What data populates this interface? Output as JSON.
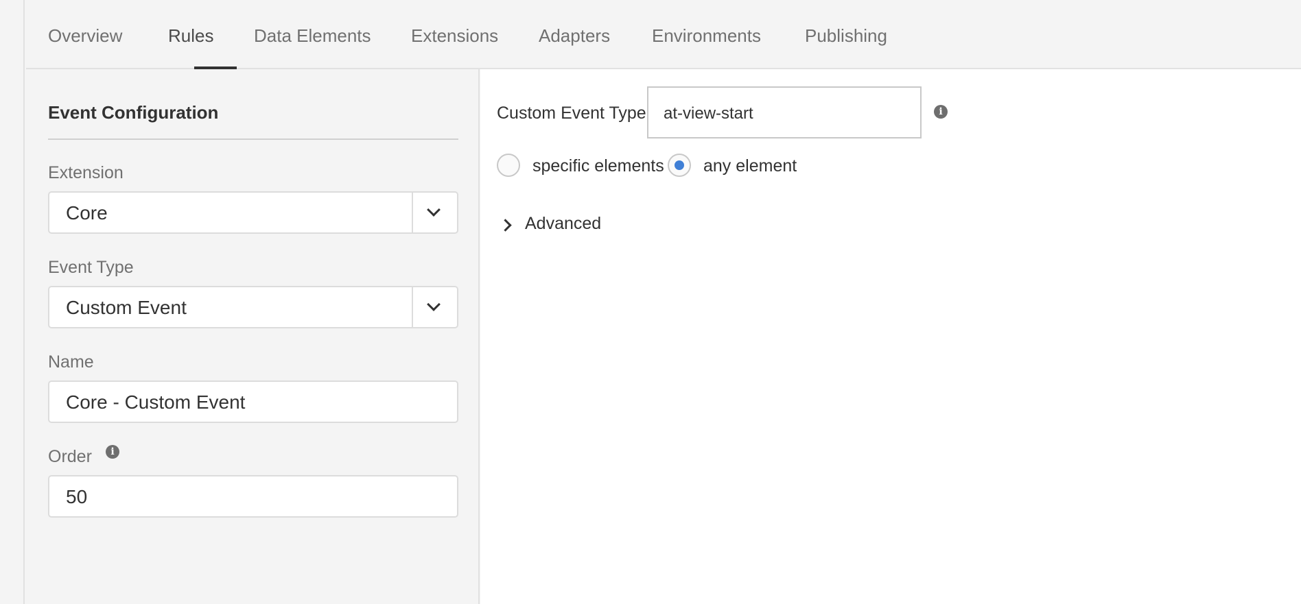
{
  "tabs": [
    {
      "label": "Overview"
    },
    {
      "label": "Rules"
    },
    {
      "label": "Data Elements"
    },
    {
      "label": "Extensions"
    },
    {
      "label": "Adapters"
    },
    {
      "label": "Environments"
    },
    {
      "label": "Publishing"
    }
  ],
  "active_tab": "Rules",
  "event_config": {
    "title": "Event Configuration",
    "extension": {
      "label": "Extension",
      "value": "Core"
    },
    "event_type": {
      "label": "Event Type",
      "value": "Custom Event"
    },
    "name": {
      "label": "Name",
      "value": "Core - Custom Event"
    },
    "order": {
      "label": "Order",
      "value": "50"
    }
  },
  "settings": {
    "custom_event_type": {
      "label": "Custom Event Type",
      "value": "at-view-start"
    },
    "target": {
      "options": [
        {
          "label": "specific elements",
          "checked": false
        },
        {
          "label": "any element",
          "checked": true
        }
      ]
    },
    "advanced_label": "Advanced"
  },
  "colors": {
    "accent": "#3f7fd6",
    "tab_underline": "#323232"
  },
  "icons": {
    "info": "info-icon",
    "dropdown": "chevron-down-icon",
    "expand": "chevron-right-icon"
  }
}
